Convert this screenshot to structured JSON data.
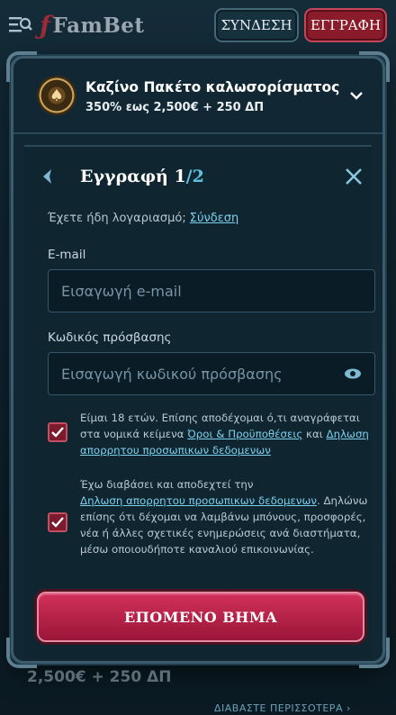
{
  "header": {
    "logo_text": "FamBet",
    "login_label": "ΣΥΝΔΕΣΗ",
    "register_label": "ΕΓΓΡΑΦΗ"
  },
  "promo": {
    "title": "Καζίνο Πακέτο καλωσορίσματος",
    "subtitle": "350% εως 2,500€ + 250 ΔΠ"
  },
  "form": {
    "title_main": "Εγγραφή 1",
    "title_sep": "/",
    "title_total": "2",
    "have_account_text": "Έχετε ήδη λογαριασμό;",
    "login_link": "Σύνδεση",
    "email_label": "E-mail",
    "email_placeholder": "Εισαγωγή e-mail",
    "password_label": "Κωδικός πρόσβασης",
    "password_placeholder": "Εισαγωγή κωδικού πρόσβασης",
    "consent1": {
      "text_before": "Είμαι 18 ετών. Επίσης αποδέχομαι ό,τι αναγράφεται στα νομικά κείμενα",
      "terms_link": "Όροι & Προϋποθέσεις",
      "and": "και",
      "privacy_link": "Δηλωση απορρητου προσωπικων δεδομενων",
      "checked": true
    },
    "consent2": {
      "text_before": "Έχω διαβάσει και αποδεχτεί την",
      "privacy_link": "Δηλωση απορρητου προσωπικων δεδομενων",
      "text_after": ". Δηλώνω επίσης ότι δέχομαι να λαμβάνω μπόνους, προσφορές, νέα ή άλλες σχετικές ενημερώσεις ανά διαστήματα, μέσω οποιουδήποτε καναλιού επικοινωνίας.",
      "checked": true
    },
    "next_button": "ΕΠΟΜΕΝΟ ΒΗΜΑ"
  },
  "background": {
    "peek_text": "2,500€ + 250 ΔΠ",
    "read_more": "ΔΙΑΒΑΣΤΕ ΠΕΡΙΣΣΟΤΕΡΑ ›"
  },
  "colors": {
    "accent": "#5cc1e2",
    "cta": "#c2244e",
    "checkbox": "#7c1b2d"
  }
}
